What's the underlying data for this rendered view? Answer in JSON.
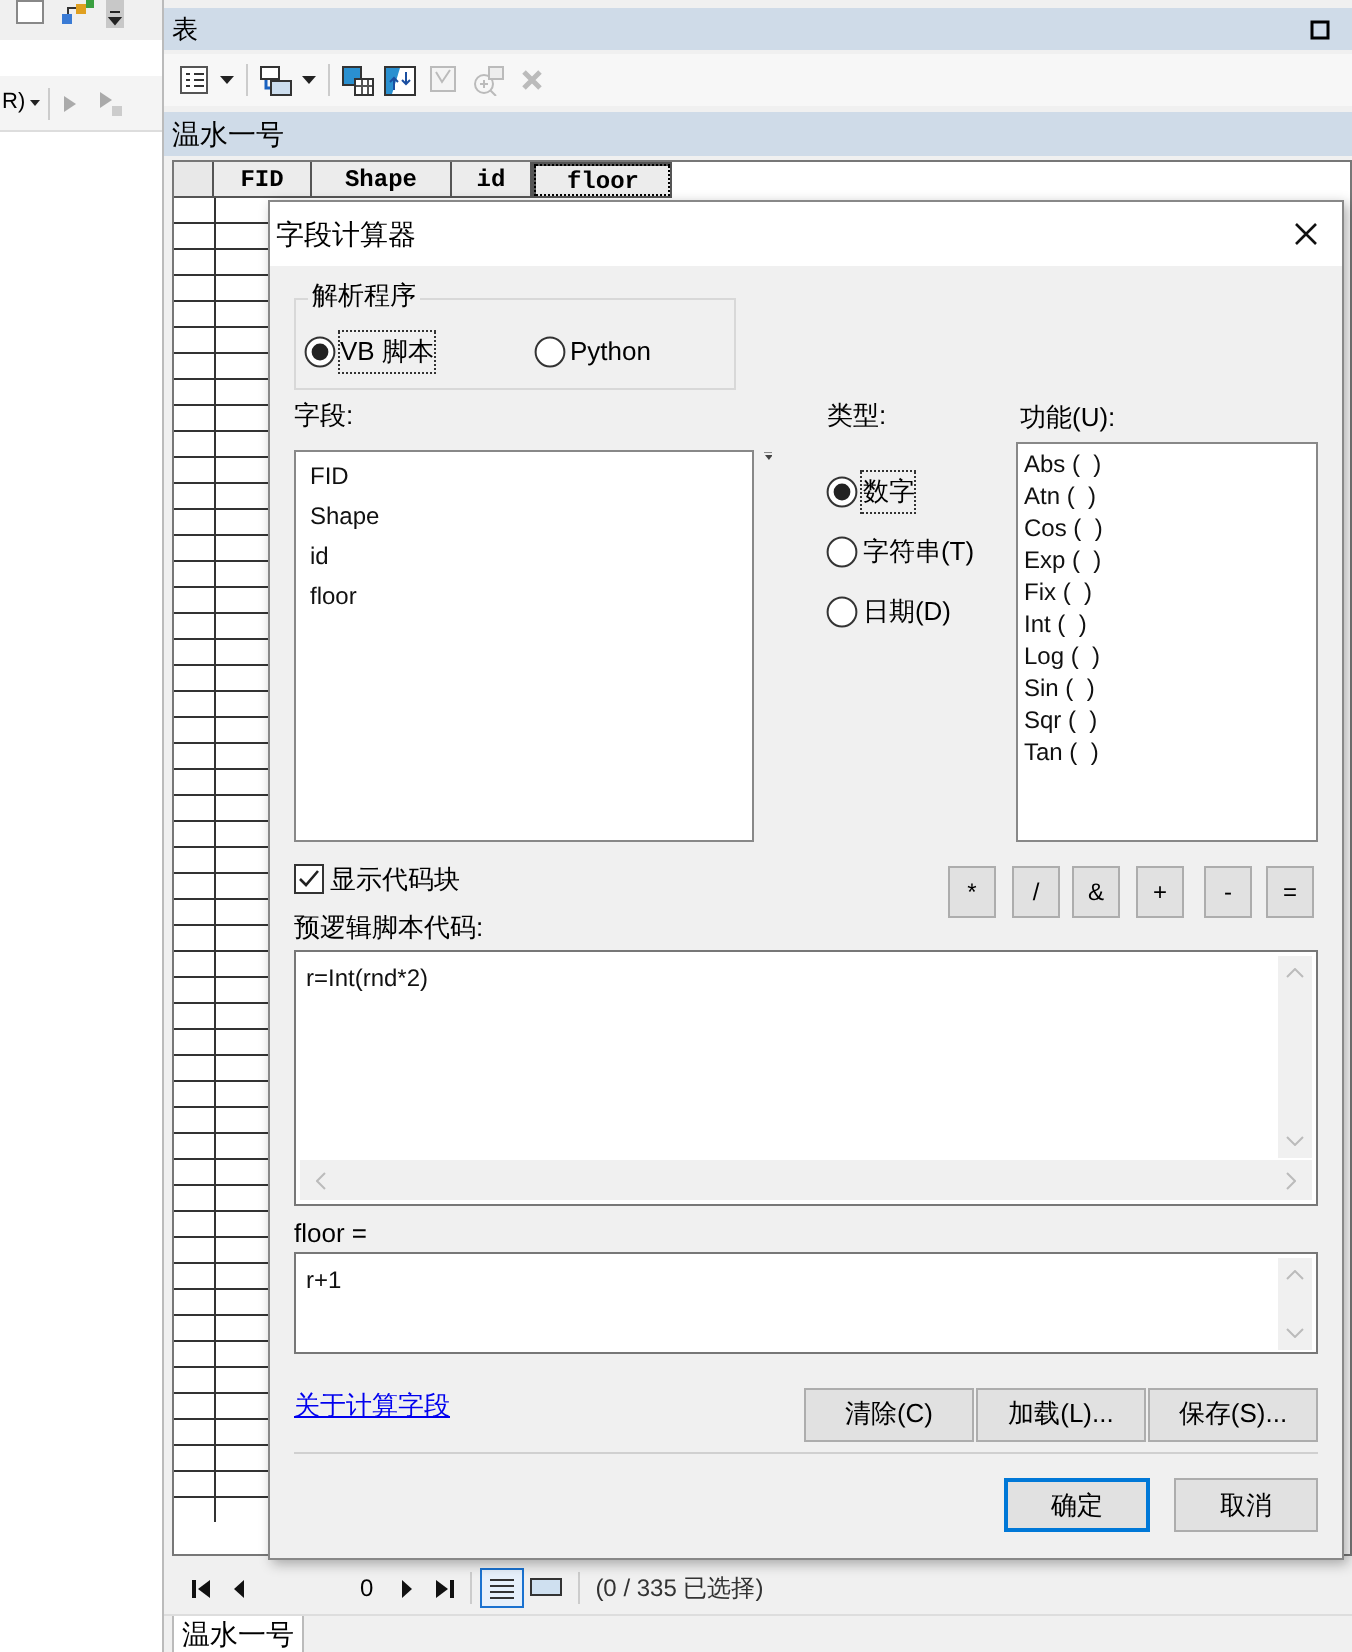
{
  "app_toolbar": {
    "dropdown_label": "R)"
  },
  "table_window": {
    "title": "表",
    "layer_tab": "温水一号",
    "columns": [
      {
        "label": "FID",
        "selected": false
      },
      {
        "label": "Shape",
        "selected": false
      },
      {
        "label": "id",
        "selected": false
      },
      {
        "label": "floor",
        "selected": true
      }
    ],
    "record": "0",
    "selection_status": "(0 / 335 已选择)",
    "bottom_tab": "温水一号"
  },
  "dialog": {
    "title": "字段计算器",
    "parser": {
      "legend": "解析程序",
      "options": [
        {
          "label": "VB 脚本",
          "selected": true
        },
        {
          "label": "Python",
          "selected": false
        }
      ]
    },
    "fields": {
      "label": "字段:",
      "items": [
        "FID",
        "Shape",
        "id",
        "floor"
      ]
    },
    "type": {
      "label": "类型:",
      "options": [
        {
          "label": "数字",
          "selected": true
        },
        {
          "label": "字符串(T)",
          "selected": false
        },
        {
          "label": "日期(D)",
          "selected": false
        }
      ]
    },
    "functions": {
      "label": "功能(U):",
      "items": [
        "Abs (  )",
        "Atn (  )",
        "Cos (  )",
        "Exp (  )",
        "Fix (  )",
        "Int (  )",
        "Log (  )",
        "Sin (  )",
        "Sqr (  )",
        "Tan (  )"
      ]
    },
    "show_codeblock": {
      "label": "显示代码块",
      "checked": true
    },
    "operators": [
      "*",
      "/",
      "&",
      "+",
      "-",
      "="
    ],
    "pre_logic": {
      "label": "预逻辑脚本代码:",
      "value": "r=Int(rnd*2)"
    },
    "expression": {
      "label": "floor =",
      "value": "r+1"
    },
    "help_link": "关于计算字段",
    "file_buttons": [
      "清除(C)",
      "加载(L)...",
      "保存(S)..."
    ],
    "buttons": [
      {
        "label": "确定",
        "default": true
      },
      {
        "label": "取消",
        "default": false
      }
    ]
  }
}
